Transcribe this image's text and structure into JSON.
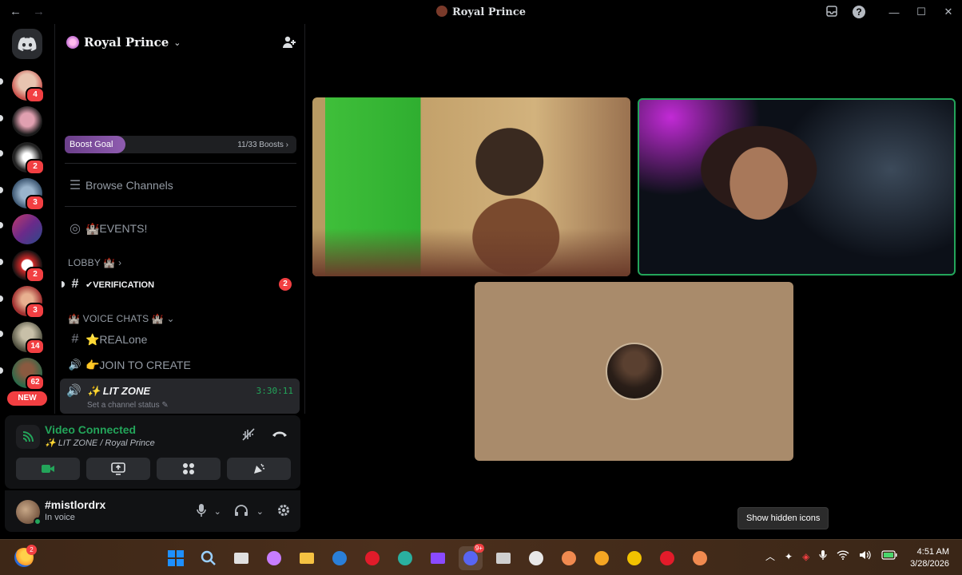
{
  "window": {
    "title": "Royal Prince",
    "back_icon": "←",
    "forward_icon": "→"
  },
  "rail": {
    "servers": [
      {
        "badge": "4",
        "color": "#c9a08a"
      },
      {
        "badge": "",
        "color": "#2a2a2a"
      },
      {
        "badge": "2",
        "color": "#1b1b1b"
      },
      {
        "badge": "3",
        "color": "#3b5570"
      },
      {
        "badge": "",
        "color": "#7a3a6a"
      },
      {
        "badge": "2",
        "color": "#cc2a2a"
      },
      {
        "badge": "3",
        "color": "#8a3a3a"
      },
      {
        "badge": "14",
        "color": "#4a4a3a"
      },
      {
        "badge": "62",
        "color": "#2a6a4a"
      }
    ],
    "new_label": "NEW"
  },
  "sidebar": {
    "server_name": "Royal Prince",
    "boost": {
      "label": "Boost Goal",
      "count": "11/33 Boosts ›"
    },
    "browse_channels": "Browse Channels",
    "events": "🏰EVENTS!",
    "lobby_category": "LOBBY 🏰 ›",
    "verification": "✔VERIFICATION",
    "verification_mentions": "2",
    "voice_category": "🏰 VOICE CHATS 🏰 ⌄",
    "channels": [
      {
        "icon": "#",
        "name": "⭐REALone"
      },
      {
        "icon": "🔊",
        "name": "👉JOIN TO CREATE"
      }
    ],
    "active_voice": {
      "name": "✨ LIT ZONE",
      "timer": "3:30:11",
      "status": "Set a channel status ✎"
    }
  },
  "voice_panel": {
    "title": "Video Connected",
    "subtitle": "✨ LIT ZONE / Royal Prince"
  },
  "user": {
    "name": "#mistlordrx",
    "status": "In voice"
  },
  "tooltip": "Show hidden icons",
  "taskbar": {
    "weather_badge": "2",
    "discord_badge": "9+",
    "apps": [
      {
        "name": "windows-start-icon",
        "color": "#1e90ff"
      },
      {
        "name": "search-icon",
        "color": "#9ad0ff"
      },
      {
        "name": "task-view-icon",
        "color": "#e0e0e0"
      },
      {
        "name": "copilot-icon",
        "color": "#c77dff"
      },
      {
        "name": "file-explorer-icon",
        "color": "#f5c242"
      },
      {
        "name": "outlook-icon",
        "color": "#2a7fd8"
      },
      {
        "name": "opera-icon",
        "color": "#e21b2a"
      },
      {
        "name": "edge-icon",
        "color": "#2ab0a0"
      },
      {
        "name": "clipchamp-icon",
        "color": "#8a4aff"
      },
      {
        "name": "discord-app-icon",
        "color": "#5865f2"
      },
      {
        "name": "camera-icon",
        "color": "#cfcfcf"
      },
      {
        "name": "steam-icon",
        "color": "#e8e8e8"
      },
      {
        "name": "game-app-1-icon",
        "color": "#f08a50"
      },
      {
        "name": "fl-studio-icon",
        "color": "#f5a623"
      },
      {
        "name": "chrome-icon",
        "color": "#f2c200"
      },
      {
        "name": "opera-gx-icon",
        "color": "#e21b2a"
      },
      {
        "name": "game-app-2-icon",
        "color": "#f08a50"
      }
    ],
    "time": "4:51 AM",
    "date": "3/28/2026"
  },
  "colors": {
    "accent_green": "#23a55a",
    "mention_red": "#f23f42",
    "boost_purple": "#8f5cb0"
  }
}
